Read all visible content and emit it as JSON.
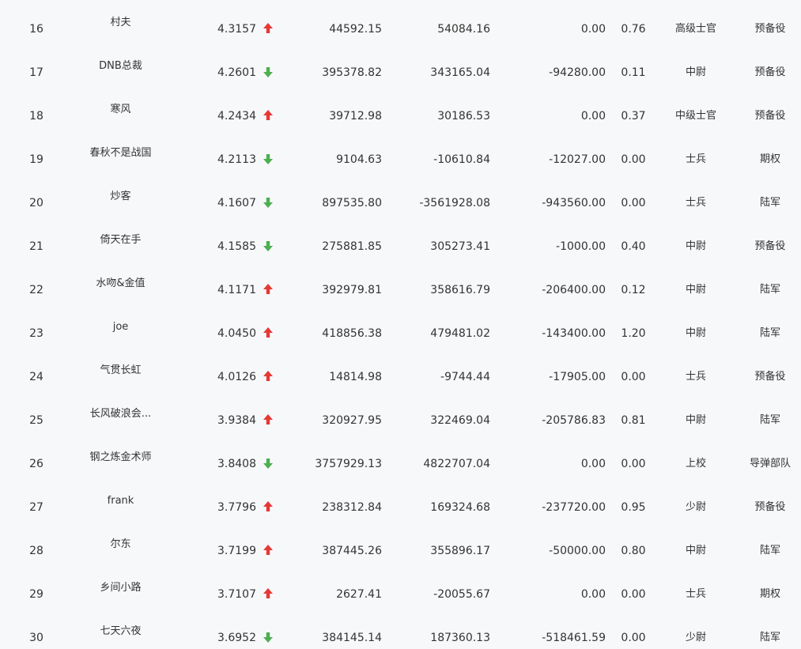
{
  "colors": {
    "up": "#e53935",
    "down": "#4caf50",
    "text": "#333333",
    "background": "#f7f8fa"
  },
  "rows": [
    {
      "rank": "16",
      "name": "村夫",
      "score": "4.3157",
      "trend": "up",
      "v1": "44592.15",
      "v2": "54084.16",
      "v3": "0.00",
      "v4": "0.76",
      "rank_title": "高级士官",
      "unit": "预备役"
    },
    {
      "rank": "17",
      "name": "DNB总裁",
      "score": "4.2601",
      "trend": "down",
      "v1": "395378.82",
      "v2": "343165.04",
      "v3": "-94280.00",
      "v4": "0.11",
      "rank_title": "中尉",
      "unit": "预备役"
    },
    {
      "rank": "18",
      "name": "寒风",
      "score": "4.2434",
      "trend": "up",
      "v1": "39712.98",
      "v2": "30186.53",
      "v3": "0.00",
      "v4": "0.37",
      "rank_title": "中级士官",
      "unit": "预备役"
    },
    {
      "rank": "19",
      "name": "春秋不是战国",
      "score": "4.2113",
      "trend": "down",
      "v1": "9104.63",
      "v2": "-10610.84",
      "v3": "-12027.00",
      "v4": "0.00",
      "rank_title": "士兵",
      "unit": "期权"
    },
    {
      "rank": "20",
      "name": "炒客",
      "score": "4.1607",
      "trend": "down",
      "v1": "897535.80",
      "v2": "-3561928.08",
      "v3": "-943560.00",
      "v4": "0.00",
      "rank_title": "士兵",
      "unit": "陆军"
    },
    {
      "rank": "21",
      "name": "倚天在手",
      "score": "4.1585",
      "trend": "down",
      "v1": "275881.85",
      "v2": "305273.41",
      "v3": "-1000.00",
      "v4": "0.40",
      "rank_title": "中尉",
      "unit": "预备役"
    },
    {
      "rank": "22",
      "name": "水吻&金值",
      "score": "4.1171",
      "trend": "up",
      "v1": "392979.81",
      "v2": "358616.79",
      "v3": "-206400.00",
      "v4": "0.12",
      "rank_title": "中尉",
      "unit": "陆军"
    },
    {
      "rank": "23",
      "name": "joe",
      "score": "4.0450",
      "trend": "up",
      "v1": "418856.38",
      "v2": "479481.02",
      "v3": "-143400.00",
      "v4": "1.20",
      "rank_title": "中尉",
      "unit": "陆军"
    },
    {
      "rank": "24",
      "name": "气贯长虹",
      "score": "4.0126",
      "trend": "up",
      "v1": "14814.98",
      "v2": "-9744.44",
      "v3": "-17905.00",
      "v4": "0.00",
      "rank_title": "士兵",
      "unit": "预备役"
    },
    {
      "rank": "25",
      "name": "长风破浪会...",
      "score": "3.9384",
      "trend": "up",
      "v1": "320927.95",
      "v2": "322469.04",
      "v3": "-205786.83",
      "v4": "0.81",
      "rank_title": "中尉",
      "unit": "陆军"
    },
    {
      "rank": "26",
      "name": "钢之炼金术师",
      "score": "3.8408",
      "trend": "down",
      "v1": "3757929.13",
      "v2": "4822707.04",
      "v3": "0.00",
      "v4": "0.00",
      "rank_title": "上校",
      "unit": "导弹部队"
    },
    {
      "rank": "27",
      "name": "frank",
      "score": "3.7796",
      "trend": "up",
      "v1": "238312.84",
      "v2": "169324.68",
      "v3": "-237720.00",
      "v4": "0.95",
      "rank_title": "少尉",
      "unit": "预备役"
    },
    {
      "rank": "28",
      "name": "尔东",
      "score": "3.7199",
      "trend": "up",
      "v1": "387445.26",
      "v2": "355896.17",
      "v3": "-50000.00",
      "v4": "0.80",
      "rank_title": "中尉",
      "unit": "陆军"
    },
    {
      "rank": "29",
      "name": "乡间小路",
      "score": "3.7107",
      "trend": "up",
      "v1": "2627.41",
      "v2": "-20055.67",
      "v3": "0.00",
      "v4": "0.00",
      "rank_title": "士兵",
      "unit": "期权"
    },
    {
      "rank": "30",
      "name": "七天六夜",
      "score": "3.6952",
      "trend": "down",
      "v1": "384145.14",
      "v2": "187360.13",
      "v3": "-518461.59",
      "v4": "0.00",
      "rank_title": "少尉",
      "unit": "陆军"
    }
  ]
}
